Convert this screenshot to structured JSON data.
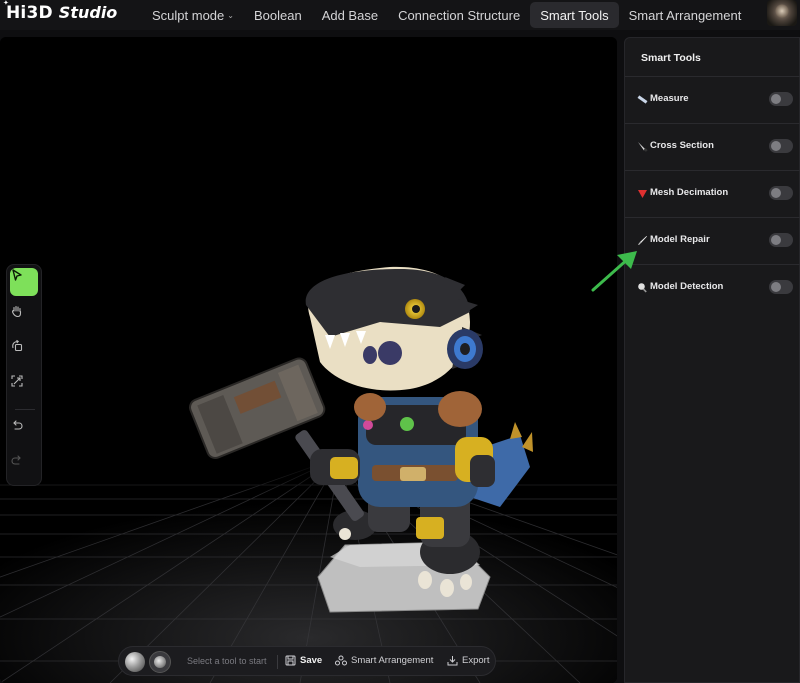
{
  "app": {
    "logo_main": "Hi3D",
    "logo_sub": "Studio"
  },
  "nav": {
    "items": [
      {
        "label": "Sculpt mode",
        "has_dropdown": true
      },
      {
        "label": "Boolean"
      },
      {
        "label": "Add Base"
      },
      {
        "label": "Connection Structure"
      },
      {
        "label": "Smart Tools",
        "active": true
      },
      {
        "label": "Smart Arrangement"
      }
    ]
  },
  "toolbar": {
    "tools": [
      "select-arrow-icon",
      "hand-pan-icon",
      "orbit-rotate-icon",
      "fit-view-icon",
      "undo-icon",
      "redo-icon"
    ],
    "active_tool": "select-arrow-icon",
    "accent_color": "#7ee05a"
  },
  "bottombar": {
    "hint": "Select a tool to start",
    "save_label": "Save",
    "arrange_label": "Smart Arrangement",
    "export_label": "Export"
  },
  "panel": {
    "title": "Smart Tools",
    "rows": [
      {
        "label": "Measure",
        "icon": "ruler-icon",
        "enabled": false
      },
      {
        "label": "Cross Section",
        "icon": "knife-icon",
        "enabled": false
      },
      {
        "label": "Mesh Decimation",
        "icon": "triangle-down-icon",
        "enabled": false
      },
      {
        "label": "Model Repair",
        "icon": "brush-icon",
        "enabled": false
      },
      {
        "label": "Model Detection",
        "icon": "magnifier-icon",
        "enabled": false
      }
    ]
  },
  "annotation": {
    "arrow_color": "#3dbb4c",
    "points_to": "Model Repair"
  }
}
